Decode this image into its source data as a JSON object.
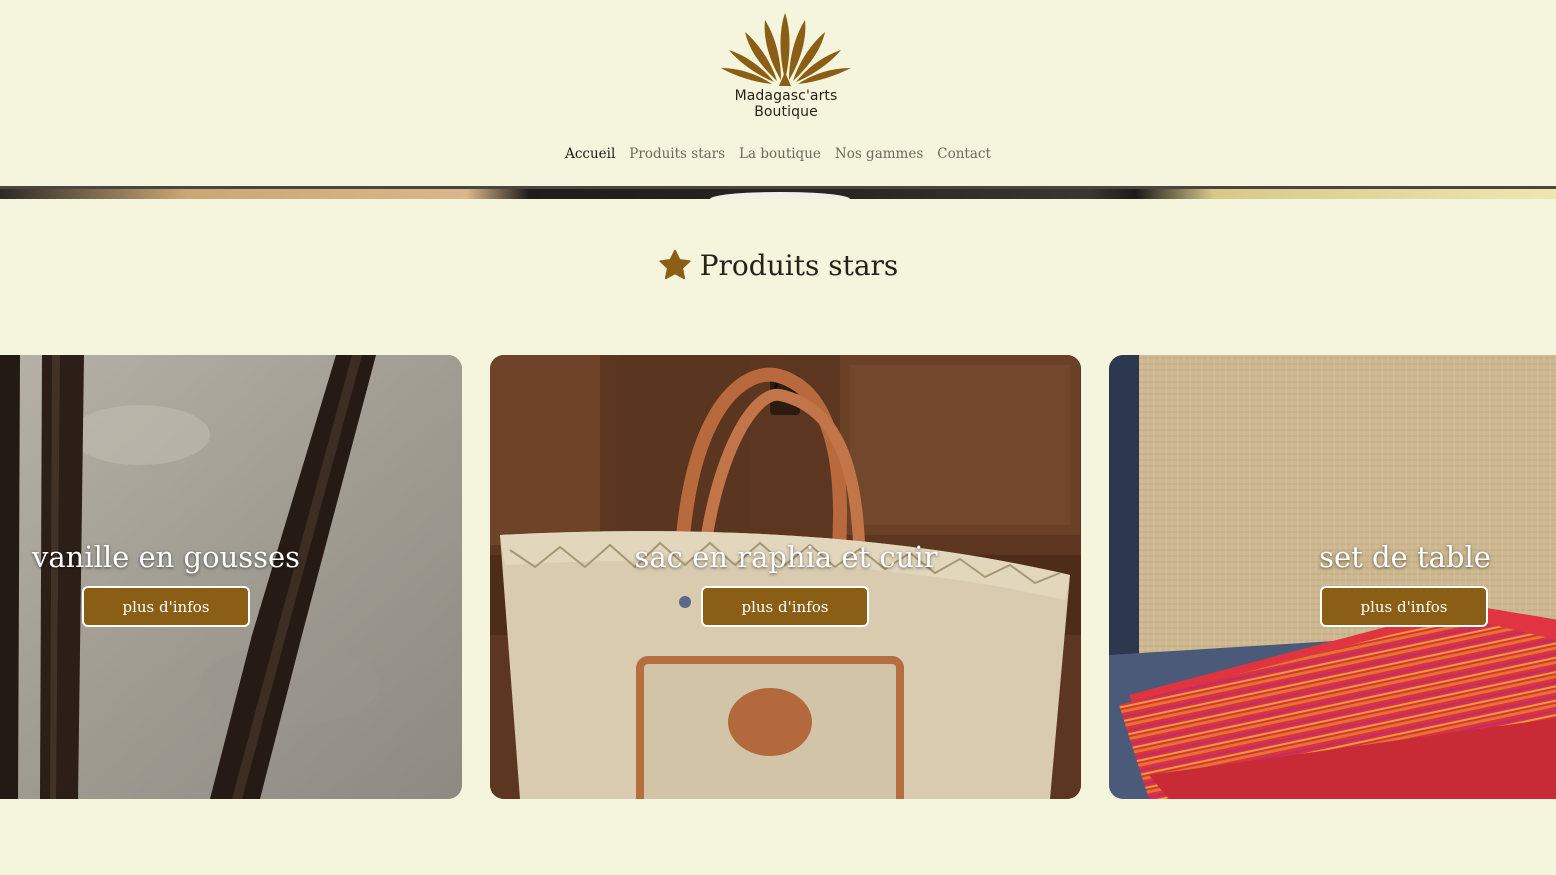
{
  "brand": {
    "name_line1": "Madagasc'arts",
    "name_line2": "Boutique",
    "accent_color": "#8a5e14"
  },
  "nav": {
    "items": [
      {
        "label": "Accueil",
        "active": true
      },
      {
        "label": "Produits stars",
        "active": false
      },
      {
        "label": "La boutique",
        "active": false
      },
      {
        "label": "Nos gammes",
        "active": false
      },
      {
        "label": "Contact",
        "active": false
      }
    ]
  },
  "section": {
    "title": "Produits stars",
    "icon": "star-icon"
  },
  "products": [
    {
      "title": "vanille en gousses",
      "button": "plus d'infos",
      "image": "vanilla-pods-photo"
    },
    {
      "title": "sac en raphia et cuir",
      "button": "plus d'infos",
      "image": "raffia-bag-photo"
    },
    {
      "title": "set de table",
      "button": "plus d'infos",
      "image": "table-set-photo"
    }
  ]
}
